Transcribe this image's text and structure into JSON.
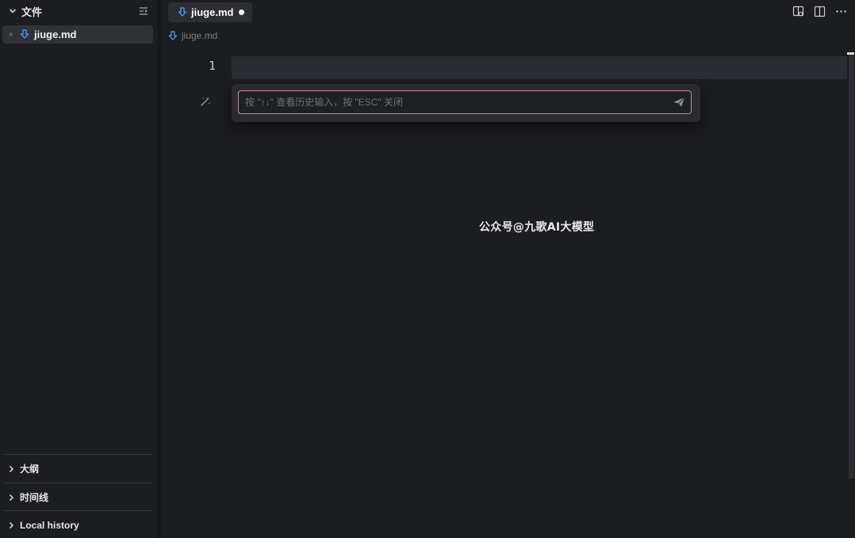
{
  "sidebar": {
    "files_section": {
      "title": "文件",
      "expanded": true,
      "collapse_icon": "collapse-all-icon"
    },
    "files": [
      {
        "name": "jiuge.md",
        "icon": "download-arrow-icon",
        "active": true
      }
    ],
    "bottom_sections": [
      {
        "label": "大纲"
      },
      {
        "label": "时间线"
      },
      {
        "label": "Local history"
      }
    ]
  },
  "editor": {
    "tab": {
      "label": "jiuge.md",
      "unsaved": true
    },
    "breadcrumb": "jiuge.md",
    "line_numbers": [
      "1"
    ],
    "actions": [
      "preview-icon",
      "split-editor-icon",
      "more-icon"
    ]
  },
  "ai_prompt": {
    "placeholder": "按 \"↑↓\" 查看历史输入，按 \"ESC\" 关闭",
    "value": "",
    "send_icon": "send-icon",
    "side_icon": "magic-wand-icon"
  },
  "watermark": "公众号@九歌AI大模型",
  "colors": {
    "background": "#1c1d21",
    "selected_item": "#303238",
    "input_border": "#c58ba6",
    "accent_icon": "#4e9fff"
  }
}
